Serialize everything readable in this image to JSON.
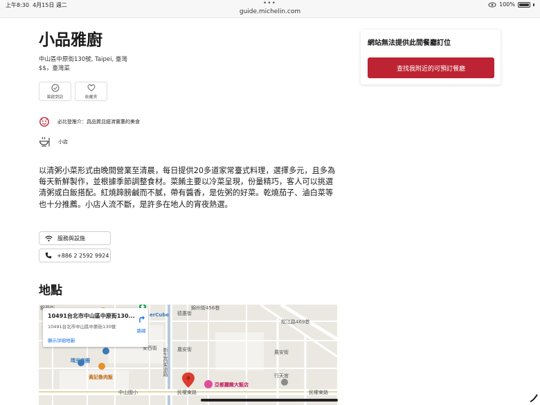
{
  "status_bar": {
    "time": "上午8:30",
    "date": "4月15日 週二",
    "url": "guide.michelin.com",
    "battery": "100%"
  },
  "restaurant": {
    "name": "小品雅廚",
    "address": "中山區中原街130號, Taipei, 臺灣",
    "price": "$$，臺灣菜"
  },
  "actions": {
    "visited_label": "曾經到訪",
    "favorite_label": "收藏夾"
  },
  "awards": {
    "bib_text": "必比登推介：具品質且經濟實惠的美食",
    "type_text": "小店"
  },
  "description": "以清粥小菜形式由晚間營業至清晨，每日提供20多道家常臺式料理，選擇多元，且多為每天新鮮製作，並根據季節調整食材。菜餚主要以冷菜呈現，份量精巧，客人可以挑選清粥或白飯搭配。紅燒蹄膀鹹而不膩，帶有醬香，是佐粥的好菜。乾燒茄子、滷白菜等也十分推薦。小店人流不斷，是許多在地人的宵夜熱選。",
  "info": {
    "facilities_label": "服務與設施",
    "phone": "+886 2 2592 9924"
  },
  "location": {
    "title": "地點",
    "card_name": "10491台北市中山區中原街130...",
    "card_address": "10491台北市中山區中原街130號",
    "directions_label": "路線",
    "view_map_label": "顯示詳細地圖",
    "labels": {
      "station": "錦西街",
      "cube": "erCube",
      "desheng": "德惠街",
      "jiuling": "錦州街456巷",
      "songjiang": "松江路469巷",
      "xinsheng": "新生高架道路",
      "qingguang": "晴光商圈",
      "huangji": "黃記魯肉飯",
      "anxi_left": "安西街",
      "anxi_mid": "安西街",
      "anxi_right": "農安街",
      "nongan": "農安街",
      "nongan_right": "農安街",
      "yadu": "亞都麗緻大飯店",
      "xingtiangong": "行天宮",
      "minquan_e": "民權東路",
      "minquan_e2": "民權東路",
      "zhongshan_elem": "中山國小",
      "lane": "中原街"
    }
  },
  "booking": {
    "heading": "網站無法提供此間餐廳訂位",
    "button_label": "查找我附近的可預訂餐廳"
  },
  "colors": {
    "brand_red": "#bd2333",
    "link_blue": "#1a73e8"
  }
}
